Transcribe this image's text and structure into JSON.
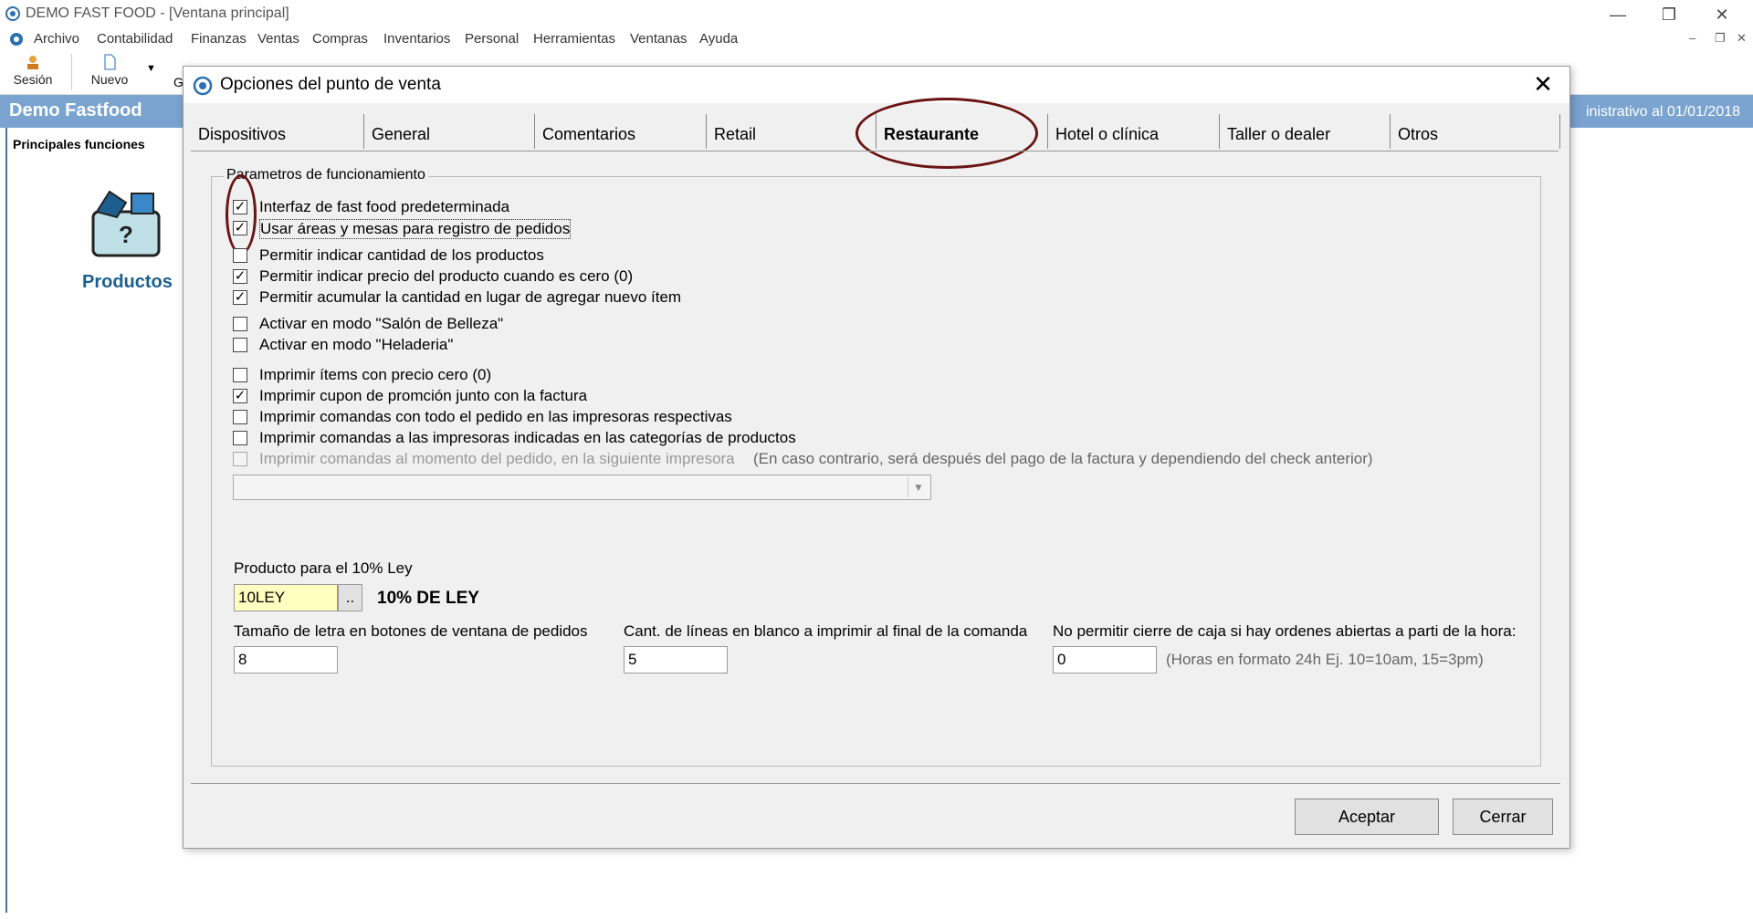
{
  "app": {
    "title": "DEMO FAST FOOD - [Ventana principal]",
    "window_controls": [
      "—",
      "❐",
      "✕"
    ]
  },
  "menu": [
    "Archivo",
    "Contabilidad",
    "Finanzas",
    "Ventas",
    "Compras",
    "Inventarios",
    "Personal",
    "Herramientas",
    "Ventanas",
    "Ayuda"
  ],
  "toolbar": {
    "session_label": "Sesión",
    "new_label": "Nuevo",
    "partial_label": "G"
  },
  "banner": {
    "title": "Demo Fastfood",
    "right_text": "inistrativo al 01/01/2018"
  },
  "sidebar": {
    "heading": "Principales funciones",
    "module_label": "Productos"
  },
  "dialog": {
    "title": "Opciones del punto de venta",
    "tabs": [
      "Dispositivos",
      "General",
      "Comentarios",
      "Retail",
      "Restaurante",
      "Hotel o clínica",
      "Taller o dealer",
      "Otros"
    ],
    "active_tab": "Restaurante",
    "group_title": "Parametros de funcionamiento",
    "checkboxes": [
      {
        "label": "Interfaz de fast food predeterminada",
        "checked": true
      },
      {
        "label": "Usar áreas y mesas para registro de pedidos",
        "checked": true
      },
      {
        "label": "Permitir indicar cantidad de los productos",
        "checked": false
      },
      {
        "label": "Permitir indicar precio del producto cuando es cero (0)",
        "checked": true
      },
      {
        "label": "Permitir acumular la cantidad en lugar de agregar nuevo ítem",
        "checked": true
      },
      {
        "label": "Activar en modo \"Salón de Belleza\"",
        "checked": false
      },
      {
        "label": "Activar en modo \"Heladeria\"",
        "checked": false
      },
      {
        "label": "Imprimir ítems con precio cero (0)",
        "checked": false
      },
      {
        "label": "Imprimir cupon de promción junto con la factura",
        "checked": true
      },
      {
        "label": "Imprimir comandas con todo el pedido en las impresoras respectivas",
        "checked": false
      },
      {
        "label": "Imprimir comandas a las impresoras indicadas en las categorías de productos",
        "checked": false
      },
      {
        "label": "Imprimir comandas al momento del pedido, en la siguiente impresora",
        "checked": false,
        "disabled": true
      }
    ],
    "print_note": "(En caso contrario, será después del pago de la factura y dependiendo del check anterior)",
    "printer_select": {
      "value": ""
    },
    "ley_product": {
      "label": "Producto para el 10% Ley",
      "value": "10LEY",
      "browse": "..",
      "description": "10% DE LEY"
    },
    "font_size": {
      "label": "Tamaño de letra en botones de ventana de pedidos",
      "value": "8"
    },
    "blank_lines": {
      "label": "Cant. de líneas en blanco a imprimir al final de la comanda",
      "value": "5"
    },
    "close_hour": {
      "label": "No permitir cierre de caja si hay ordenes abiertas a parti de la hora:",
      "value": "0",
      "hint": "(Horas en formato 24h Ej. 10=10am, 15=3pm)"
    },
    "accept_label": "Aceptar",
    "close_label": "Cerrar"
  },
  "colors": {
    "banner": "#7aa3cf",
    "annotation": "#6b1414",
    "ley_field": "#ffffc0"
  }
}
